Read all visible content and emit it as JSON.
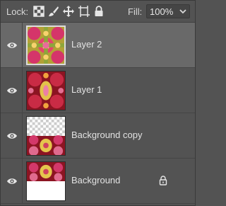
{
  "lock_bar": {
    "lock_label": "Lock:",
    "lock_icons": [
      "lock-transparent-pixels-icon",
      "lock-image-pixels-icon",
      "lock-position-icon",
      "lock-artboard-icon",
      "lock-all-icon"
    ],
    "fill_label": "Fill:",
    "fill_value": "100%"
  },
  "layers": [
    {
      "name": "Layer 2",
      "visible": true,
      "selected": true,
      "thumb": "layer2-kaleidoscope",
      "locked": false
    },
    {
      "name": "Layer 1",
      "visible": true,
      "selected": false,
      "thumb": "layer1-kaleidoscope",
      "locked": false
    },
    {
      "name": "Background copy",
      "visible": true,
      "selected": false,
      "thumb": "bg-copy-checker",
      "locked": false
    },
    {
      "name": "Background",
      "visible": true,
      "selected": false,
      "thumb": "bg-white-bottom",
      "locked": true
    }
  ],
  "colors": {
    "panel_bg": "#535353",
    "selected_row": "#696969",
    "text": "#e2e2e2"
  }
}
